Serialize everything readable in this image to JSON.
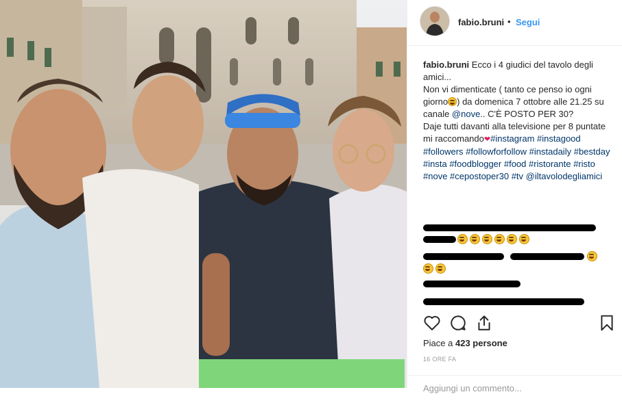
{
  "post": {
    "username": "fabio.bruni",
    "dot": "•",
    "follow_label": "Segui",
    "caption": {
      "username": "fabio.bruni",
      "t1": "Ecco i 4 giudici del tavolo degli amici...",
      "t2": "Non vi dimenticate ( tanto ce penso io ogni giorno",
      "t3": ") da domenica 7 ottobre alle 21.25 su canale ",
      "mention_nove": "@nove",
      "t4": ".. C'È POSTO PER 30?",
      "t5": "Daje tutti davanti alla televisione per 8 puntate mi raccomando",
      "hashtags": [
        "#instagram",
        "#instagood",
        "#followers",
        "#followforfollow",
        "#instadaily",
        "#bestday",
        "#insta",
        "#foodblogger",
        "#food",
        "#ristorante",
        "#risto",
        "#nove",
        "#cepostoper30",
        "#tv"
      ],
      "mention_end": "@iltavolodegliamici"
    },
    "likes_prefix": "Piace a ",
    "likes_count": "423 persone",
    "time": "16 ORE FA",
    "add_comment_placeholder": "Aggiungi un commento..."
  },
  "icons": {
    "like": "heart-outline-icon",
    "comment": "comment-bubble-icon",
    "share": "share-upload-icon",
    "save": "bookmark-icon"
  },
  "colors": {
    "link": "#003569",
    "follow": "#3897f0",
    "text": "#262626",
    "muted": "#999999"
  }
}
